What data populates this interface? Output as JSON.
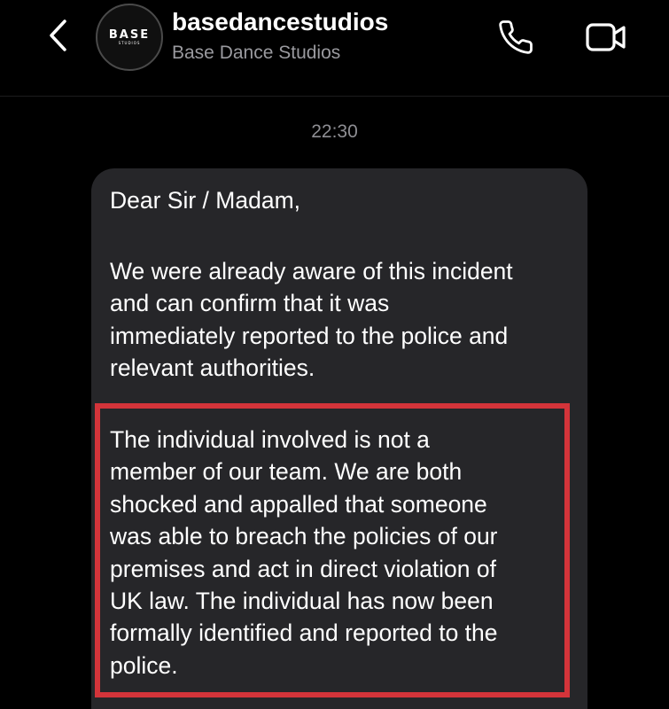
{
  "header": {
    "username": "basedancestudios",
    "display_name": "Base Dance Studios",
    "avatar": {
      "logo_text": "BASE",
      "logo_subtext": "STUDIOS"
    },
    "icons": {
      "back": "chevron-left-icon",
      "call": "phone-icon",
      "video": "video-camera-icon"
    }
  },
  "conversation": {
    "timestamp": "22:30",
    "message": {
      "paragraphs": [
        "Dear Sir / Madam,",
        "We were already aware of this incident\nand can confirm that it was\nimmediately reported to the police and\nrelevant authorities.",
        "The individual involved is not a\nmember of our team. We are both\nshocked and appalled that someone\nwas able to breach the policies of our\npremises and act in direct violation of\nUK law. The individual has now been\nformally identified and reported to the\npolice."
      ]
    }
  },
  "colors": {
    "background": "#000000",
    "bubble": "#262629",
    "secondary_text": "#9a9a9f",
    "highlight_border": "#d3343a"
  }
}
